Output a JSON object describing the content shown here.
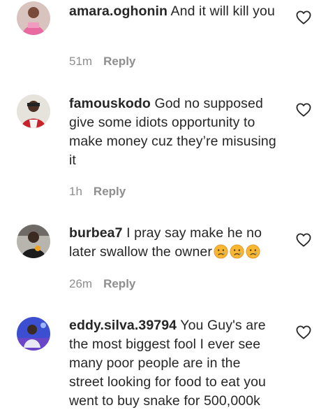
{
  "comments": [
    {
      "username": "amara.oghonin",
      "text": "And it will kill you",
      "time": "51m",
      "reply": "Reply",
      "avatar": "avatar-pink",
      "like_icon": "heart-outline-icon"
    },
    {
      "username": "famouskodo",
      "text": "God no supposed give some idiots opportunity to make money cuz they’re misusing it",
      "time": "1h",
      "reply": "Reply",
      "avatar": "avatar-red",
      "like_icon": "heart-outline-icon"
    },
    {
      "username": "burbea7",
      "text": "I pray say make he no later swallow the owner",
      "emojis": [
        "crying-face",
        "crying-face",
        "crying-face"
      ],
      "time": "26m",
      "reply": "Reply",
      "avatar": "avatar-gray",
      "like_icon": "heart-outline-icon"
    },
    {
      "username": "eddy.silva.39794",
      "text": "You Guy's are the most biggest fool I ever see many poor people are in the street looking for food to eat you went to buy snake for 500,000k",
      "time": "",
      "reply": "",
      "avatar": "avatar-blue",
      "like_icon": "heart-outline-icon"
    }
  ]
}
